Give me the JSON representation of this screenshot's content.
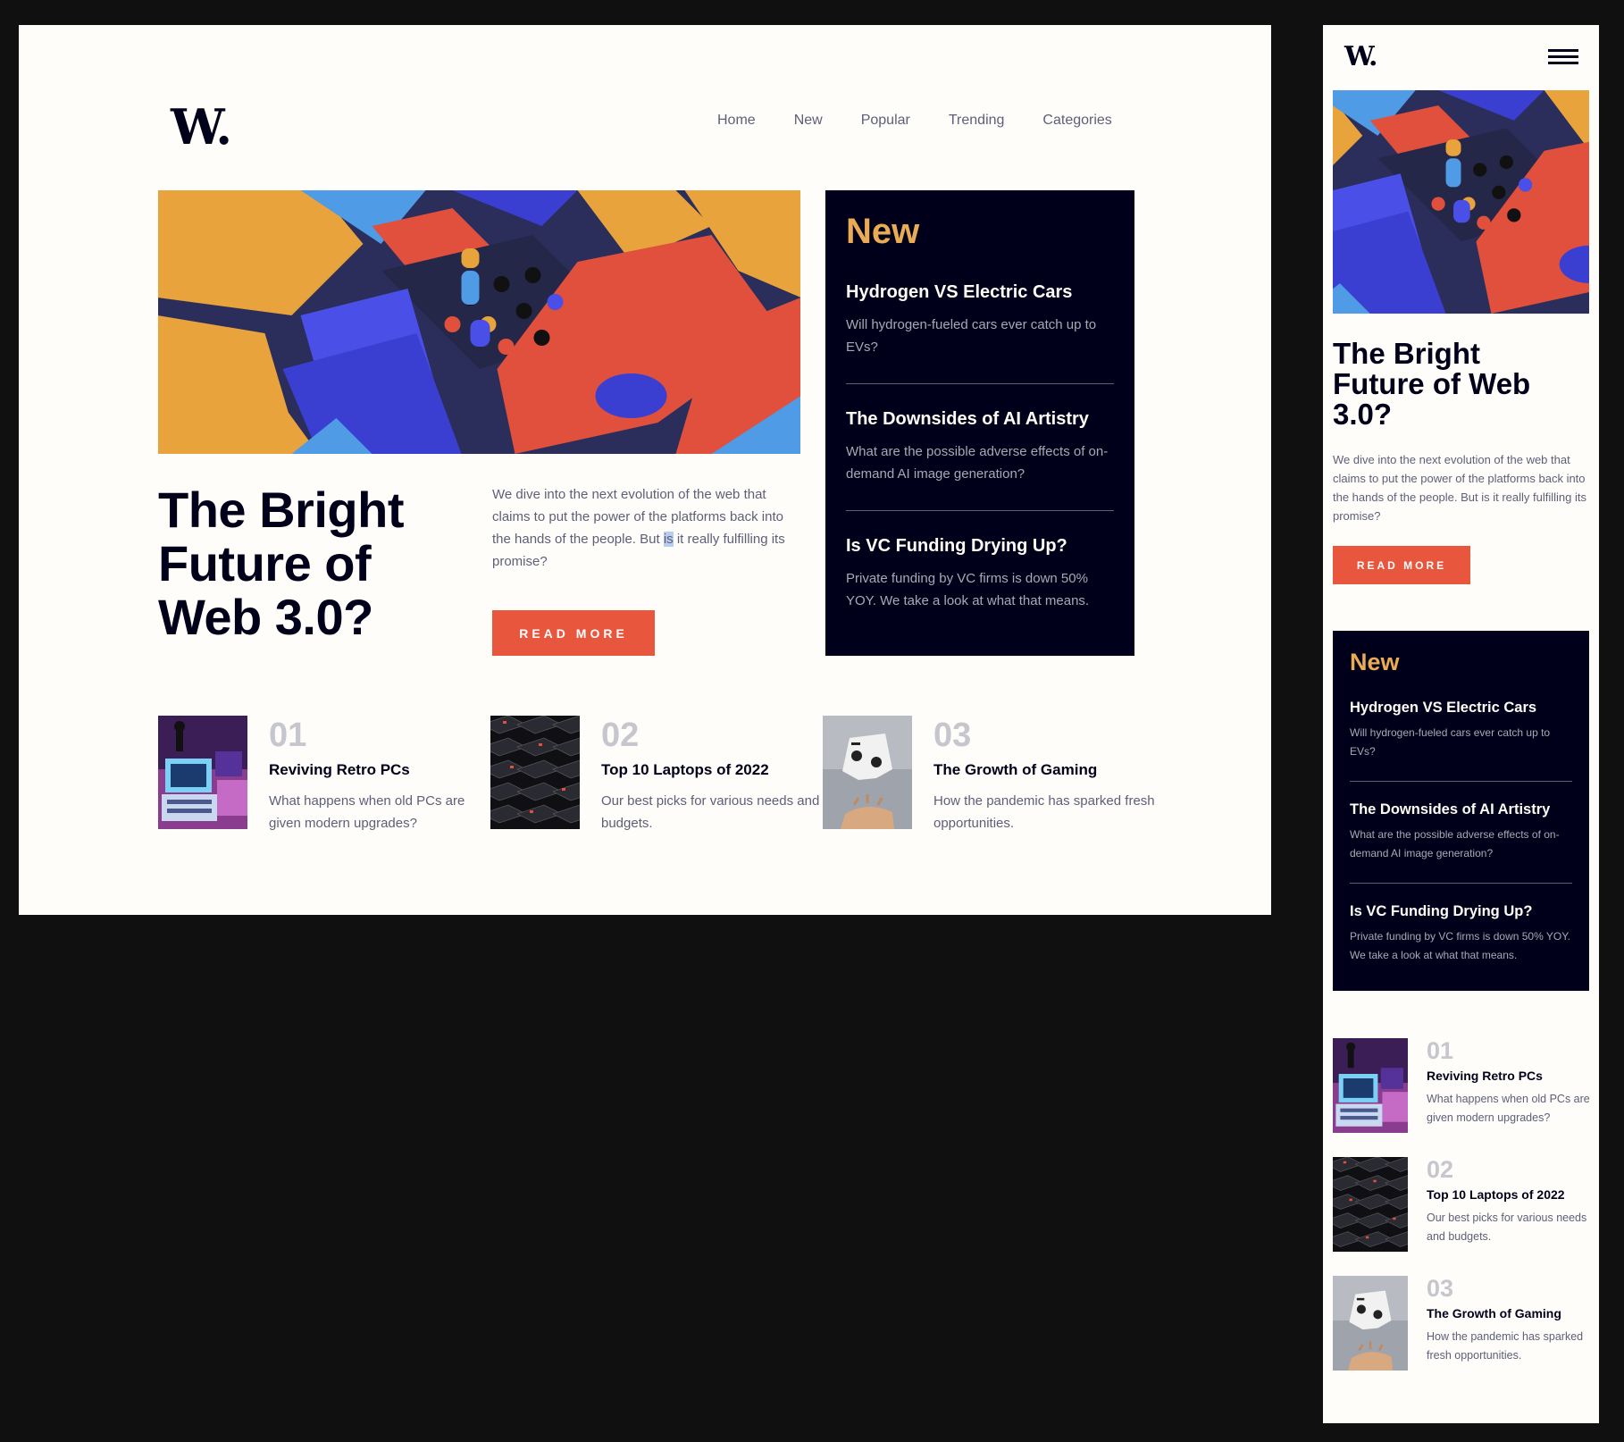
{
  "brand": {
    "logo": "W."
  },
  "nav": {
    "items": [
      "Home",
      "New",
      "Popular",
      "Trending",
      "Categories"
    ],
    "menu_icon": "hamburger-menu-icon"
  },
  "hero": {
    "title": "The Bright Future of Web 3.0?",
    "title_lines": [
      "The Bright",
      "Future of",
      "Web 3.0?"
    ],
    "mobile_title_lines": [
      "The Bright",
      "Future of Web",
      "3.0?"
    ],
    "description_before": "We dive into the next evolution of the web that claims to put the power of the platforms back into the hands of the people. But ",
    "description_highlight": "is",
    "description_after": " it really fulfilling its promise?",
    "description": "We dive into the next evolution of the web that claims to put the power of the platforms back into the hands of the people. But is it really fulfilling its promise?",
    "button_label": "READ MORE",
    "image": "abstract-3d-blocks-image"
  },
  "new_section": {
    "heading": "New",
    "items": [
      {
        "title": "Hydrogen VS Electric Cars",
        "text": "Will hydrogen-fueled cars ever catch up to EVs?"
      },
      {
        "title": "The Downsides of AI Artistry",
        "text": "What are the possible adverse effects of on-demand AI image generation?"
      },
      {
        "title": "Is VC Funding Drying Up?",
        "text": "Private funding by VC firms is down 50% YOY. We take a look at what that means."
      }
    ]
  },
  "articles": [
    {
      "number": "01",
      "title": "Reviving Retro PCs",
      "text": "What happens when old PCs are given modern upgrades?",
      "image": "retro-pc-image"
    },
    {
      "number": "02",
      "title": "Top 10 Laptops of 2022",
      "text": "Our best picks for various needs and budgets.",
      "image": "keyboard-image"
    },
    {
      "number": "03",
      "title": "The Growth of Gaming",
      "text": "How the pandemic has sparked fresh opportunities.",
      "image": "gamepad-image"
    }
  ],
  "colors": {
    "accent_red": "#e9563e",
    "accent_gold": "#e9ab53",
    "dark_navy": "#00001a",
    "grayish_blue": "#5d5f79",
    "grayish_light": "#c5c6ce",
    "off_white": "#fffdf9"
  }
}
